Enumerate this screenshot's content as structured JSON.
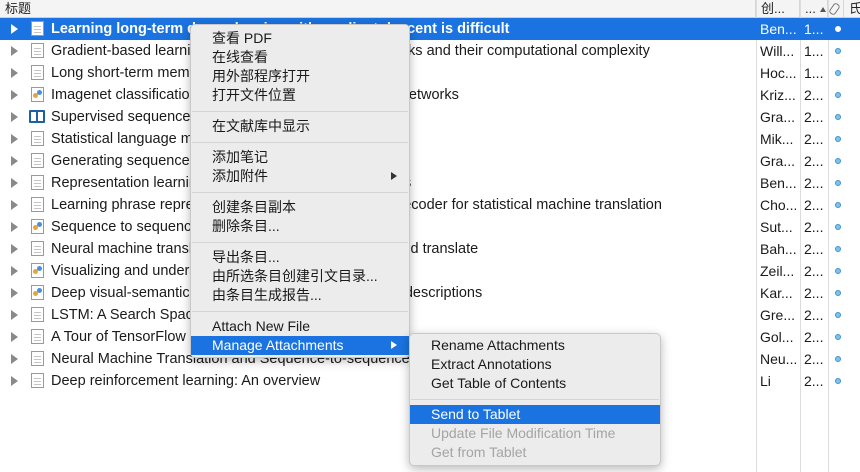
{
  "columns": {
    "title": "标题",
    "creator": "创...",
    "date": "...",
    "attachments_icon": "paperclip",
    "extra": "氏"
  },
  "rows": [
    {
      "title": "Learning long-term dependencies with gradient descent is difficult",
      "creator": "Ben...",
      "date": "1...",
      "icon": "document",
      "selected": true
    },
    {
      "title": "Gradient-based learning algorithms for recurrent networks and their computational complexity",
      "creator": "Will...",
      "date": "1...",
      "icon": "document"
    },
    {
      "title": "Long short-term memory",
      "creator": "Hoc...",
      "date": "1...",
      "icon": "document"
    },
    {
      "title": "Imagenet classification with deep convolutional neural networks",
      "creator": "Kriz...",
      "date": "2...",
      "icon": "image"
    },
    {
      "title": "Supervised sequence labelling",
      "creator": "Gra...",
      "date": "2...",
      "icon": "book"
    },
    {
      "title": "Statistical language models based on neural networks",
      "creator": "Mik...",
      "date": "2...",
      "icon": "document"
    },
    {
      "title": "Generating sequences with recurrent neural networks",
      "creator": "Gra...",
      "date": "2...",
      "icon": "document"
    },
    {
      "title": "Representation learning: A review and new perspectives",
      "creator": "Ben...",
      "date": "2...",
      "icon": "document"
    },
    {
      "title": "Learning phrase representations using RNN encoder-decoder for statistical machine translation",
      "creator": "Cho...",
      "date": "2...",
      "icon": "document"
    },
    {
      "title": "Sequence to sequence learning with neural networks",
      "creator": "Sut...",
      "date": "2...",
      "icon": "image"
    },
    {
      "title": "Neural machine translation by jointly learning to align and translate",
      "creator": "Bah...",
      "date": "2...",
      "icon": "document"
    },
    {
      "title": "Visualizing and understanding convolutional networks",
      "creator": "Zeil...",
      "date": "2...",
      "icon": "image"
    },
    {
      "title": "Deep visual-semantic alignments for generating image descriptions",
      "creator": "Kar...",
      "date": "2...",
      "icon": "image"
    },
    {
      "title": "LSTM: A Search Space Odyssey",
      "creator": "Gre...",
      "date": "2...",
      "icon": "document"
    },
    {
      "title": "A Tour of TensorFlow",
      "creator": "Gol...",
      "date": "2...",
      "icon": "document"
    },
    {
      "title": "Neural Machine Translation and Sequence-to-sequence Models: A Tutorial",
      "creator": "Neu...",
      "date": "2...",
      "icon": "document"
    },
    {
      "title": "Deep reinforcement learning: An overview",
      "creator": "Li",
      "date": "2...",
      "icon": "document"
    }
  ],
  "context_menu": {
    "groups": [
      [
        "查看 PDF",
        "在线查看",
        "用外部程序打开",
        "打开文件位置"
      ],
      [
        "在文献库中显示"
      ],
      [
        "添加笔记",
        "添加附件"
      ],
      [
        "创建条目副本",
        "删除条目..."
      ],
      [
        "导出条目...",
        "由所选条目创建引文目录...",
        "由条目生成报告..."
      ],
      [
        "Attach New File",
        "Manage Attachments"
      ]
    ],
    "submenu_items": [
      "添加附件",
      "Manage Attachments"
    ],
    "highlighted": "Manage Attachments"
  },
  "submenu": {
    "groups": [
      [
        "Rename Attachments",
        "Extract Annotations",
        "Get Table of Contents"
      ],
      [
        "Send to Tablet",
        "Update File Modification Time",
        "Get from Tablet"
      ]
    ],
    "highlighted": "Send to Tablet",
    "disabled": [
      "Update File Modification Time",
      "Get from Tablet"
    ]
  },
  "colors": {
    "selection": "#1a73e0",
    "menu_bg": "#ececec",
    "attachment_dot": "#7fc2ee"
  }
}
